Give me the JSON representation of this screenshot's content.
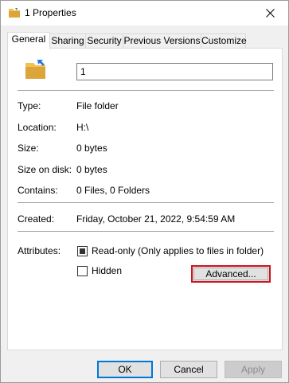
{
  "window": {
    "title": "1 Properties",
    "close_icon": "close-icon"
  },
  "tabs": [
    {
      "label": "General",
      "active": true
    },
    {
      "label": "Sharing",
      "active": false
    },
    {
      "label": "Security",
      "active": false
    },
    {
      "label": "Previous Versions",
      "active": false
    },
    {
      "label": "Customize",
      "active": false
    }
  ],
  "general": {
    "name_value": "1",
    "type_label": "Type:",
    "type_value": "File folder",
    "location_label": "Location:",
    "location_value": "H:\\",
    "size_label": "Size:",
    "size_value": "0 bytes",
    "size_on_disk_label": "Size on disk:",
    "size_on_disk_value": "0 bytes",
    "contains_label": "Contains:",
    "contains_value": "0 Files, 0 Folders",
    "created_label": "Created:",
    "created_value": "Friday, October 21, 2022, 9:54:59 AM",
    "attributes_label": "Attributes:",
    "readonly_label": "Read-only (Only applies to files in folder)",
    "readonly_checked": true,
    "hidden_label": "Hidden",
    "hidden_checked": false,
    "advanced_label": "Advanced..."
  },
  "buttons": {
    "ok": "OK",
    "cancel": "Cancel",
    "apply": "Apply"
  },
  "colors": {
    "folder": "#f4c04e",
    "folder_dark": "#dca53b",
    "highlight": "#d0141e",
    "accent": "#0078d7"
  }
}
